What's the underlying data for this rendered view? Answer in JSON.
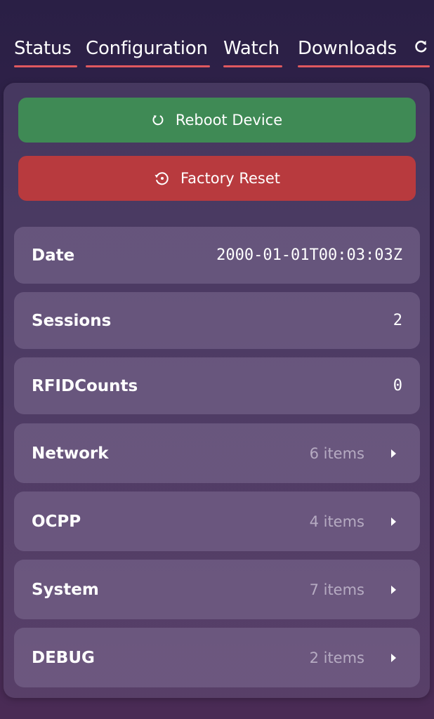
{
  "tabs": [
    {
      "label": "Status"
    },
    {
      "label": "Configuration"
    },
    {
      "label": "Watch"
    },
    {
      "label": "Downloads"
    }
  ],
  "actions": {
    "reboot_label": "Reboot Device",
    "reset_label": "Factory Reset"
  },
  "status_rows": [
    {
      "label": "Date",
      "value": "2000-01-01T00:03:03Z"
    },
    {
      "label": "Sessions",
      "value": "2"
    },
    {
      "label": "RFIDCounts",
      "value": "0"
    }
  ],
  "groups": [
    {
      "label": "Network",
      "count": "6 items"
    },
    {
      "label": "OCPP",
      "count": "4 items"
    },
    {
      "label": "System",
      "count": "7 items"
    },
    {
      "label": "DEBUG",
      "count": "2 items"
    }
  ],
  "colors": {
    "accent_underline": "#e0595f",
    "reboot_button": "#3f8a55",
    "reset_button": "#b83a3e"
  },
  "icons": {
    "refresh": "refresh-icon",
    "reboot": "rotate-icon",
    "reset": "history-icon",
    "expand": "caret-right-icon"
  }
}
